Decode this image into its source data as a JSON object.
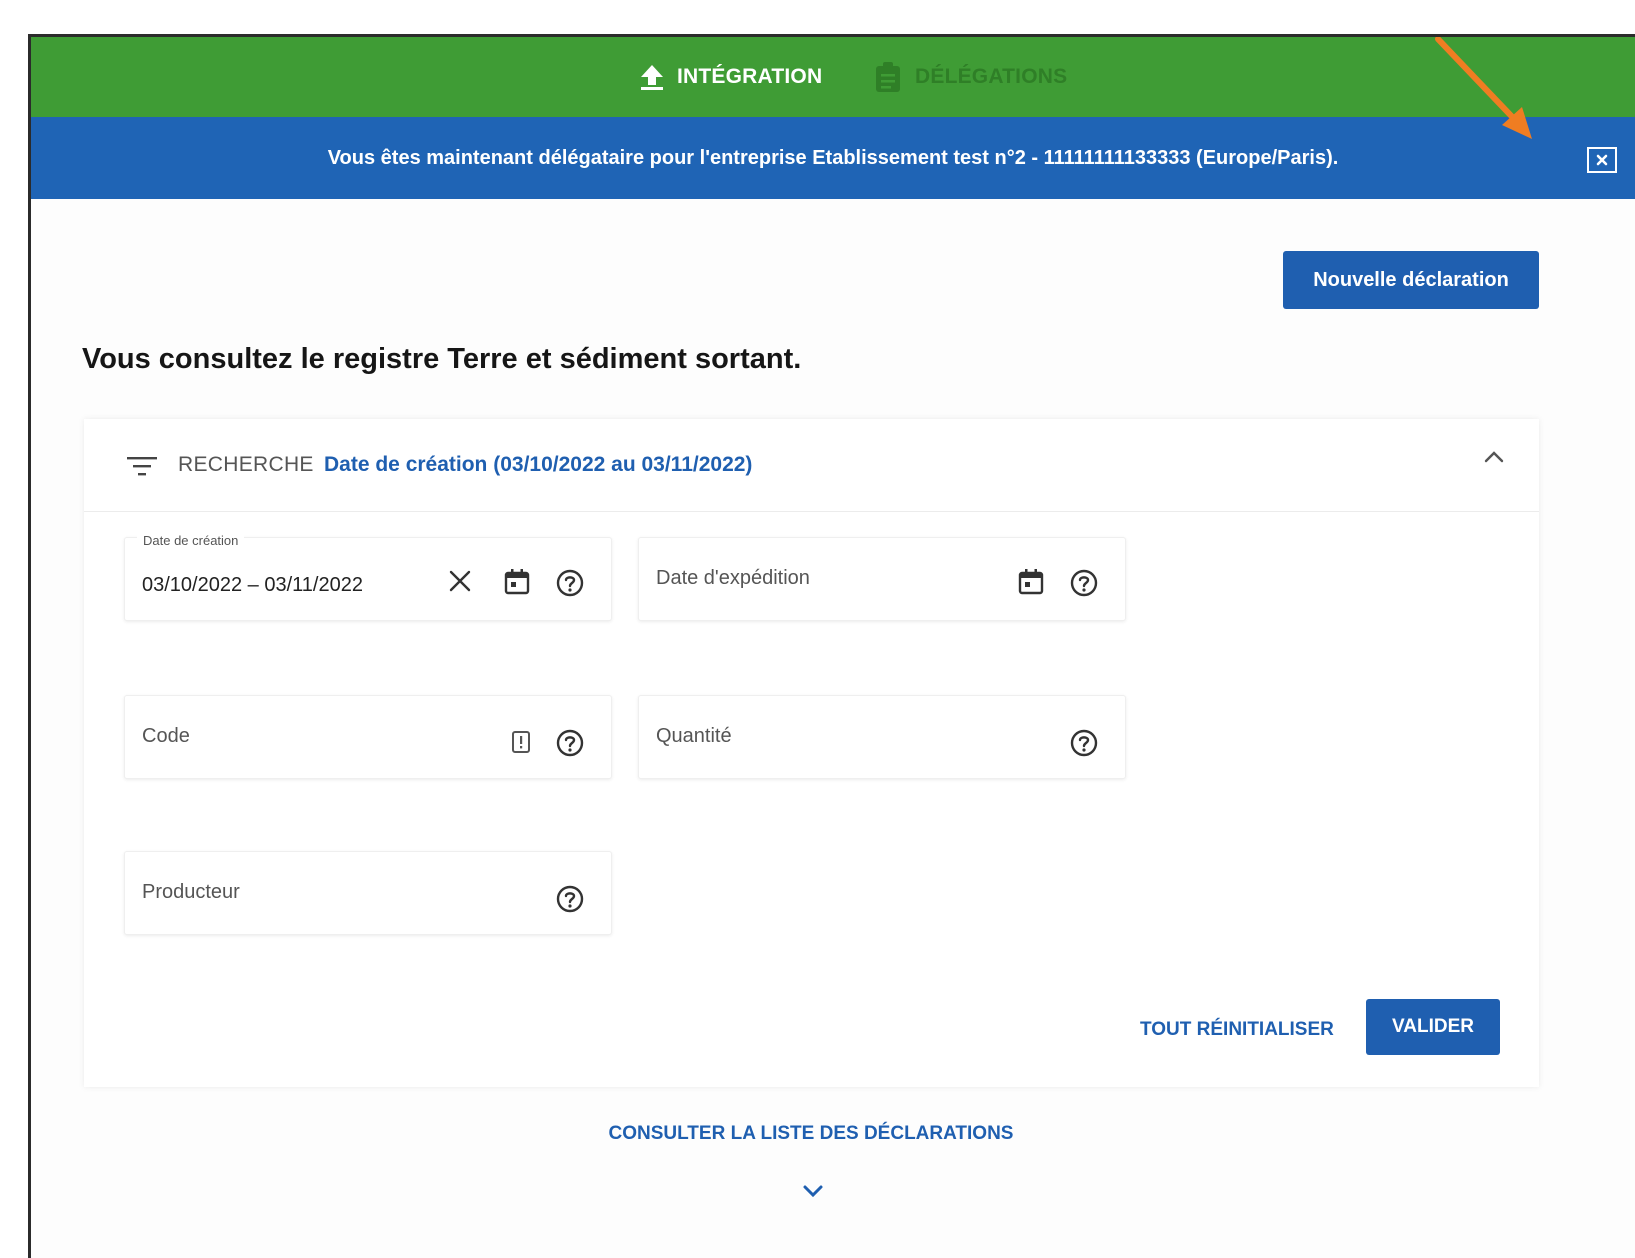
{
  "tabs": [
    {
      "label": "INTÉGRATION",
      "icon": "upload-icon",
      "active": true
    },
    {
      "label": "DÉLÉGATIONS",
      "icon": "clipboard-icon",
      "active": false
    }
  ],
  "banner": {
    "message": "Vous êtes maintenant délégataire pour l'entreprise Etablissement test n°2 - 11111111133333 (Europe/Paris).",
    "close_icon": "close-box-icon"
  },
  "toolbar": {
    "new_declaration_label": "Nouvelle déclaration"
  },
  "page": {
    "title": "Vous consultez le registre Terre et sédiment sortant."
  },
  "search": {
    "label": "RECHERCHE",
    "summary": "Date de création (03/10/2022 au 03/11/2022)",
    "fields": {
      "creation_date": {
        "label": "Date de création",
        "value": "03/10/2022 – 03/11/2022"
      },
      "shipping_date": {
        "placeholder": "Date d'expédition"
      },
      "code": {
        "placeholder": "Code"
      },
      "quantity": {
        "placeholder": "Quantité"
      },
      "producer": {
        "placeholder": "Producteur"
      }
    },
    "reset_label": "TOUT RÉINITIALISER",
    "validate_label": "VALIDER"
  },
  "footer": {
    "list_link_label": "CONSULTER LA LISTE DES DÉCLARATIONS"
  },
  "colors": {
    "tabbar": "#3f9c35",
    "banner": "#1f64b5",
    "primary": "#1f5fb0",
    "annotation_arrow": "#ef7d22"
  }
}
